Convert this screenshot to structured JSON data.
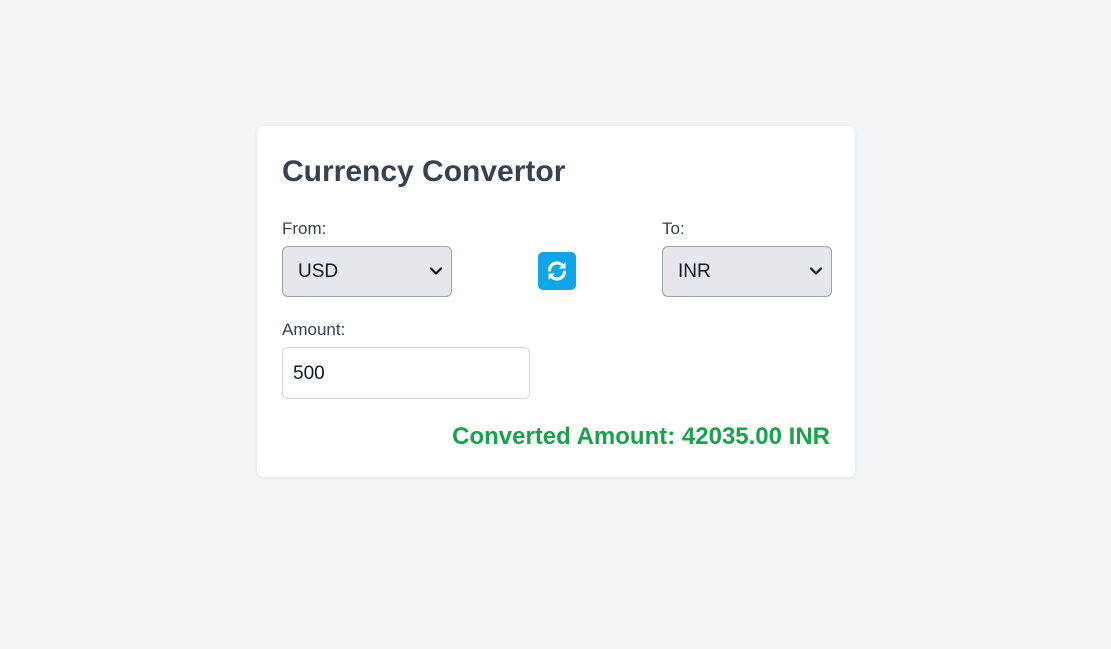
{
  "app": {
    "title": "Currency Convertor"
  },
  "from": {
    "label": "From:",
    "selected": "USD"
  },
  "to": {
    "label": "To:",
    "selected": "INR"
  },
  "swap": {
    "icon": "swap-refresh-icon",
    "color": "#0ea5e9"
  },
  "amount": {
    "label": "Amount:",
    "value": "500"
  },
  "result": {
    "text": "Converted Amount: 42035.00 INR",
    "color": "#16a34a"
  }
}
